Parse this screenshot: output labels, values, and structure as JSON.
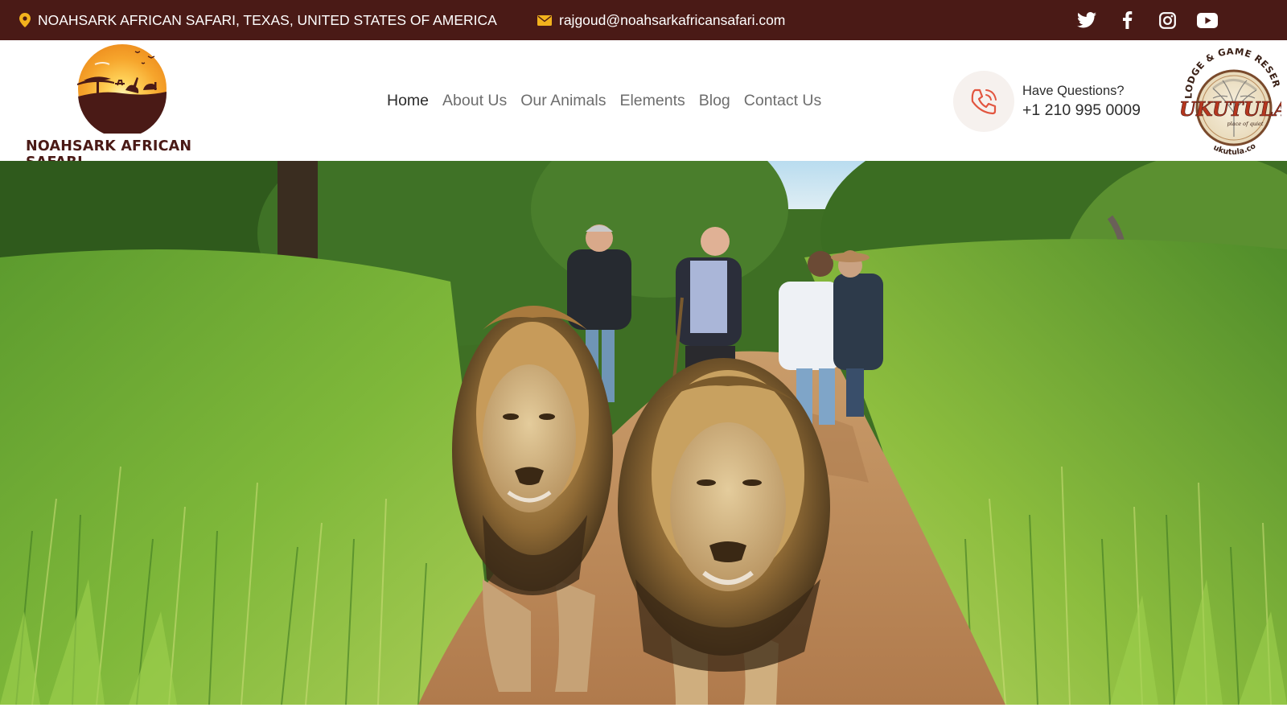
{
  "topbar": {
    "address": "NOAHSARK AFRICAN SAFARI, TEXAS, UNITED STATES OF AMERICA",
    "email": "rajgoud@noahsarkafricansafari.com",
    "social": [
      "twitter-icon",
      "facebook-icon",
      "instagram-icon",
      "youtube-icon"
    ]
  },
  "brand": {
    "name": "NOAHSARK AFRICAN SAFARI"
  },
  "nav": {
    "items": [
      "Home",
      "About Us",
      "Our Animals",
      "Elements",
      "Blog",
      "Contact Us"
    ],
    "active": "Home"
  },
  "phone": {
    "question": "Have Questions?",
    "number": "+1 210 995 0009"
  },
  "partner": {
    "arc_text": "LODGE & GAME RESERVE",
    "name": "UKUTULA",
    "tagline": "place of quiet",
    "url": "ukutula.com"
  },
  "colors": {
    "topbar_bg": "#4a1a16",
    "brand_text": "#4a1a16",
    "accent": "#e2553f",
    "nav_text": "#6d6d6d",
    "nav_active": "#2b2b2b",
    "icon_yellow": "#f2b21d"
  },
  "hero": {
    "subject": "two male lions walking on a dirt track ahead of four men in the bush"
  }
}
